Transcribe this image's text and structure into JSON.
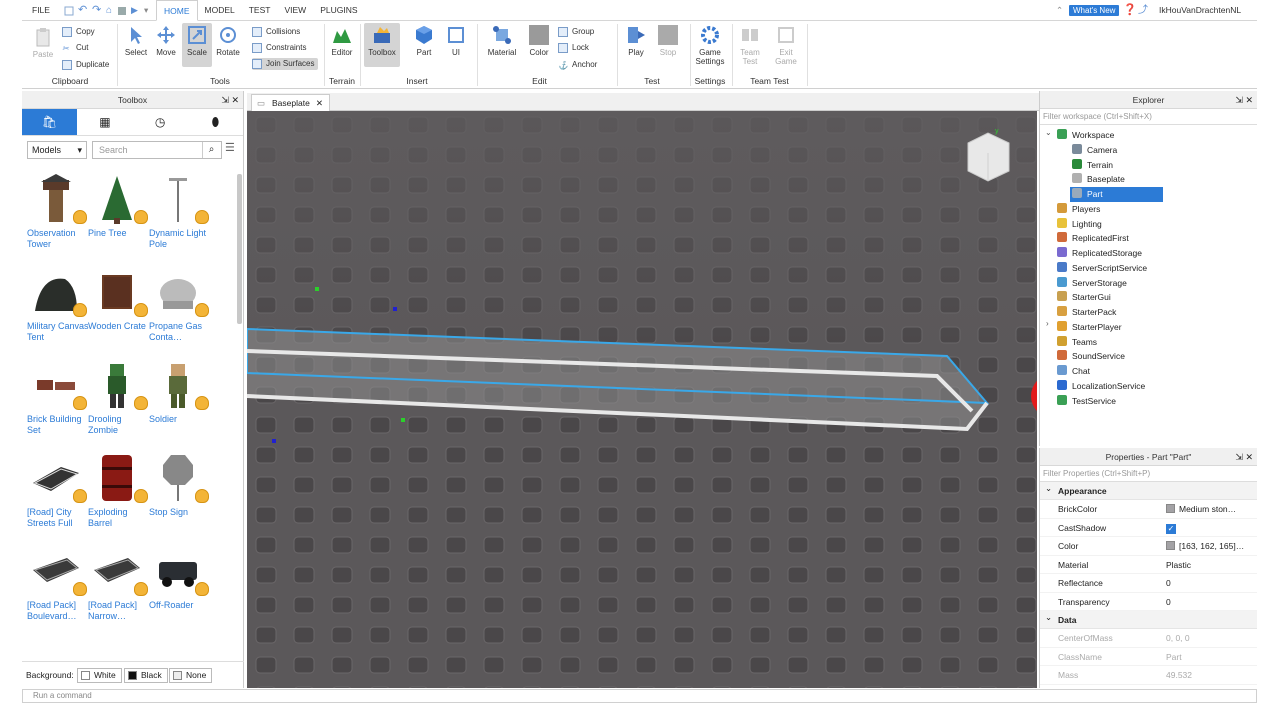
{
  "title_bar": {
    "file": "FILE",
    "tabs": [
      "HOME",
      "MODEL",
      "TEST",
      "VIEW",
      "PLUGINS"
    ],
    "whats_new": "What's New",
    "username": "IkHouVanDrachtenNL"
  },
  "ribbon": {
    "clipboard": {
      "paste": "Paste",
      "copy": "Copy",
      "cut": "Cut",
      "duplicate": "Duplicate",
      "label": "Clipboard"
    },
    "tools": {
      "select": "Select",
      "move": "Move",
      "scale": "Scale",
      "rotate": "Rotate",
      "collisions": "Collisions",
      "constraints": "Constraints",
      "join_surfaces": "Join Surfaces",
      "label": "Tools"
    },
    "terrain": {
      "editor": "Editor",
      "label": "Terrain"
    },
    "insert": {
      "toolbox": "Toolbox",
      "part": "Part",
      "ui": "UI",
      "label": "Insert"
    },
    "edit": {
      "material": "Material",
      "color": "Color",
      "group": "Group",
      "lock": "Lock",
      "anchor": "Anchor",
      "label": "Edit"
    },
    "test": {
      "play": "Play",
      "stop": "Stop",
      "label": "Test"
    },
    "settings": {
      "game_settings_1": "Game",
      "game_settings_2": "Settings",
      "label": "Settings"
    },
    "team_test": {
      "team_test_1": "Team",
      "team_test_2": "Test",
      "exit_game_1": "Exit",
      "exit_game_2": "Game",
      "label": "Team Test"
    }
  },
  "toolbox": {
    "title": "Toolbox",
    "category": "Models",
    "search_placeholder": "Search",
    "items": [
      {
        "name": "Observation Tower",
        "icon": "watchtower-icon"
      },
      {
        "name": "Pine Tree",
        "icon": "pine-tree-icon"
      },
      {
        "name": "Dynamic Light Pole",
        "icon": "light-pole-icon"
      },
      {
        "name": "Military Canvas Tent",
        "icon": "tent-icon"
      },
      {
        "name": "Wooden Crate",
        "icon": "crate-icon"
      },
      {
        "name": "Propane Gas Conta…",
        "icon": "propane-tank-icon"
      },
      {
        "name": "Brick Building Set",
        "icon": "brick-set-icon"
      },
      {
        "name": "Drooling Zombie",
        "icon": "zombie-icon"
      },
      {
        "name": "Soldier",
        "icon": "soldier-icon"
      },
      {
        "name": "[Road] City Streets Full",
        "icon": "road-icon"
      },
      {
        "name": "Exploding Barrel",
        "icon": "barrel-icon"
      },
      {
        "name": "Stop Sign",
        "icon": "stop-sign-icon"
      },
      {
        "name": "[Road Pack] Boulevard…",
        "icon": "road-pack-icon"
      },
      {
        "name": "[Road Pack] Narrow…",
        "icon": "road-pack-icon"
      },
      {
        "name": "Off-Roader",
        "icon": "car-icon"
      }
    ],
    "background_label": "Background:",
    "bg_options": [
      "White",
      "Black",
      "None"
    ]
  },
  "document_tab": "Baseplate",
  "explorer": {
    "title": "Explorer",
    "filter_placeholder": "Filter workspace (Ctrl+Shift+X)",
    "nodes": [
      {
        "label": "Workspace",
        "depth": 0,
        "color": "#3aa055"
      },
      {
        "label": "Camera",
        "depth": 1,
        "color": "#7a8a9a"
      },
      {
        "label": "Terrain",
        "depth": 1,
        "color": "#2a8a3a"
      },
      {
        "label": "Baseplate",
        "depth": 1,
        "color": "#b0b0b0"
      },
      {
        "label": "Part",
        "depth": 1,
        "color": "#9ab",
        "selected": true
      },
      {
        "label": "Players",
        "depth": 0,
        "color": "#d49a3a"
      },
      {
        "label": "Lighting",
        "depth": 0,
        "color": "#e8c23a"
      },
      {
        "label": "ReplicatedFirst",
        "depth": 0,
        "color": "#d06a3a"
      },
      {
        "label": "ReplicatedStorage",
        "depth": 0,
        "color": "#7a6ad0"
      },
      {
        "label": "ServerScriptService",
        "depth": 0,
        "color": "#4a7ac8"
      },
      {
        "label": "ServerStorage",
        "depth": 0,
        "color": "#4a9ad0"
      },
      {
        "label": "StarterGui",
        "depth": 0,
        "color": "#c8a050"
      },
      {
        "label": "StarterPack",
        "depth": 0,
        "color": "#d8a040"
      },
      {
        "label": "StarterPlayer",
        "depth": 0,
        "color": "#e0a030"
      },
      {
        "label": "Teams",
        "depth": 0,
        "color": "#d0a030"
      },
      {
        "label": "SoundService",
        "depth": 0,
        "color": "#d06a3a"
      },
      {
        "label": "Chat",
        "depth": 0,
        "color": "#6a9ad0"
      },
      {
        "label": "LocalizationService",
        "depth": 0,
        "color": "#2c6ad0"
      },
      {
        "label": "TestService",
        "depth": 0,
        "color": "#3aa055"
      }
    ]
  },
  "properties": {
    "title": "Properties - Part \"Part\"",
    "filter_placeholder": "Filter Properties (Ctrl+Shift+P)",
    "sections": [
      {
        "name": "Appearance",
        "rows": [
          {
            "k": "BrickColor",
            "v": "Medium ston…",
            "swatch": "#a3a2a5"
          },
          {
            "k": "CastShadow",
            "v": "✓",
            "check": true
          },
          {
            "k": "Color",
            "v": "[163, 162, 165]…",
            "swatch": "#a3a2a5"
          },
          {
            "k": "Material",
            "v": "Plastic"
          },
          {
            "k": "Reflectance",
            "v": "0"
          },
          {
            "k": "Transparency",
            "v": "0"
          }
        ]
      },
      {
        "name": "Data",
        "rows": [
          {
            "k": "CenterOfMass",
            "v": "0, 0, 0",
            "dim": true
          },
          {
            "k": "ClassName",
            "v": "Part",
            "dim": true
          },
          {
            "k": "Mass",
            "v": "49.532",
            "dim": true
          }
        ]
      }
    ]
  },
  "command_bar_placeholder": "Run a command"
}
